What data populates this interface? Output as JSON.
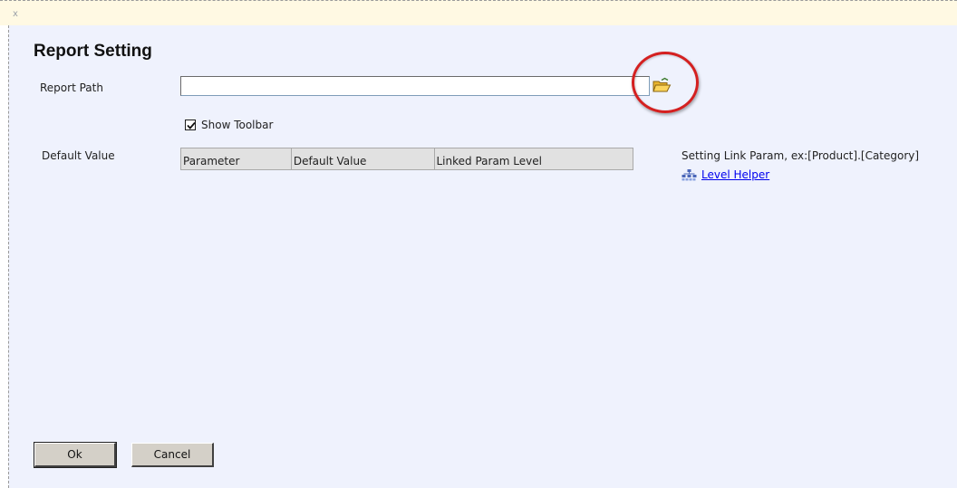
{
  "window": {
    "close_label": "x"
  },
  "dialog": {
    "title": "Report Setting",
    "report_path": {
      "label": "Report Path",
      "value": ""
    },
    "show_toolbar": {
      "label": "Show Toolbar",
      "checked": true
    },
    "default_value": {
      "label": "Default Value",
      "columns": [
        "Parameter",
        "Default Value",
        "Linked Param Level"
      ]
    },
    "link_param_hint": "Setting Link Param, ex:[Product].[Category]",
    "level_helper_label": "Level Helper",
    "buttons": {
      "ok": "Ok",
      "cancel": "Cancel"
    }
  },
  "icons": {
    "browse": "open-folder-icon",
    "level_helper": "hierarchy-icon"
  },
  "colors": {
    "panel_background": "#eff2fd",
    "top_bar": "#fff9e3",
    "highlight_circle": "#d42020",
    "link": "#0000ee"
  }
}
